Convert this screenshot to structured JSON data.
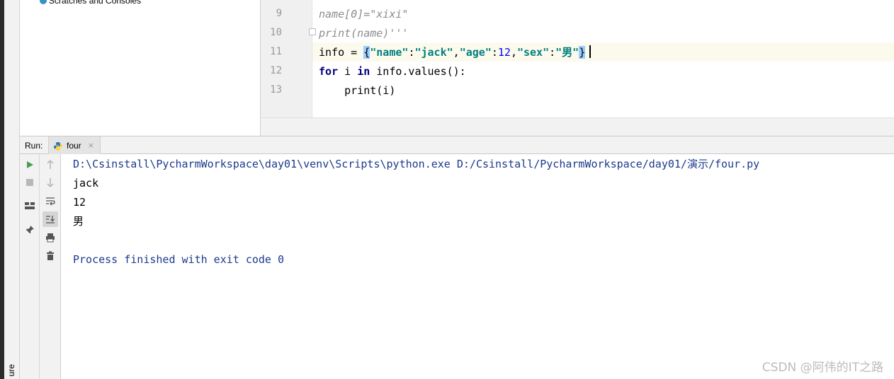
{
  "project_tree": {
    "scratches_label": "Scratches and Consoles"
  },
  "editor": {
    "lines": [
      {
        "number": "9",
        "text": "name[0]=\"xixi\""
      },
      {
        "number": "10",
        "text": "print(name)'''"
      },
      {
        "number": "11",
        "text": "info = {\"name\":\"jack\",\"age\":12,\"sex\":\"男\"}"
      },
      {
        "number": "12",
        "text": "for i in info.values():"
      },
      {
        "number": "13",
        "text": "    print(i)"
      }
    ],
    "current_line": "11"
  },
  "run_panel": {
    "label": "Run:",
    "tab_name": "four",
    "tab_close": "×",
    "output": {
      "command": "D:\\Csinstall\\PycharmWorkspace\\day01\\venv\\Scripts\\python.exe D:/Csinstall/PycharmWorkspace/day01/演示/four.py",
      "lines": [
        "jack",
        "12",
        "男"
      ],
      "exit_message": "Process finished with exit code 0"
    },
    "toolbar_icons": [
      "run-icon",
      "stop-icon",
      "layout-icon",
      "pin-icon",
      "up-arrow-icon",
      "down-arrow-icon",
      "soft-wrap-icon",
      "scroll-to-end-icon",
      "print-icon",
      "trash-icon"
    ]
  },
  "side_label": "ure",
  "watermark": "CSDN @阿伟的IT之路",
  "colors": {
    "keyword": "#000080",
    "string": "#008080",
    "number": "#0000ff",
    "comment": "#8c8c8c",
    "console_system": "#1c3a8c",
    "caret_row": "#fcfaed",
    "brace_highlight": "#99ccff",
    "run_green": "#499c54"
  }
}
